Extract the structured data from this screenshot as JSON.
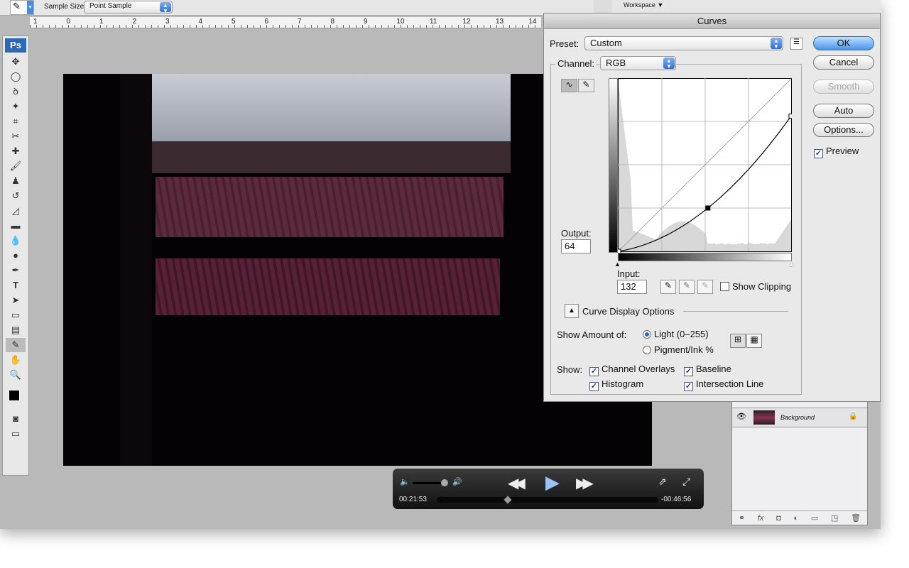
{
  "options_bar": {
    "sample_size_label": "Sample Size:",
    "sample_size_value": "Point Sample",
    "workspace_label": "Workspace"
  },
  "ruler": {
    "labels": [
      "1",
      "0",
      "1",
      "2",
      "3",
      "4",
      "5",
      "6",
      "7",
      "8",
      "9",
      "10",
      "11",
      "12",
      "13",
      "14"
    ]
  },
  "toolbox": {
    "logo": "Ps"
  },
  "curves": {
    "title": "Curves",
    "preset_label": "Preset:",
    "preset_value": "Custom",
    "channel_label": "Channel:",
    "channel_value": "RGB",
    "output_label": "Output:",
    "output_value": "64",
    "input_label": "Input:",
    "input_value": "132",
    "show_clipping": "Show Clipping",
    "buttons": {
      "ok": "OK",
      "cancel": "Cancel",
      "smooth": "Smooth",
      "auto": "Auto",
      "options": "Options..."
    },
    "preview_label": "Preview",
    "display_options": "Curve Display Options",
    "show_amount_label": "Show Amount of:",
    "light": "Light  (0–255)",
    "pigment": "Pigment/Ink %",
    "show_label": "Show:",
    "channel_overlays": "Channel Overlays",
    "baseline": "Baseline",
    "histogram": "Histogram",
    "intersection_line": "Intersection Line",
    "curve_points": [
      [
        0,
        0
      ],
      [
        132,
        64
      ],
      [
        255,
        200
      ]
    ]
  },
  "player": {
    "elapsed": "00:21:53",
    "remaining": "-00:46:56",
    "progress": 0.32,
    "volume": 0.85
  },
  "layers": {
    "items": [
      {
        "name": "Background",
        "locked": true,
        "visible": true
      }
    ]
  }
}
